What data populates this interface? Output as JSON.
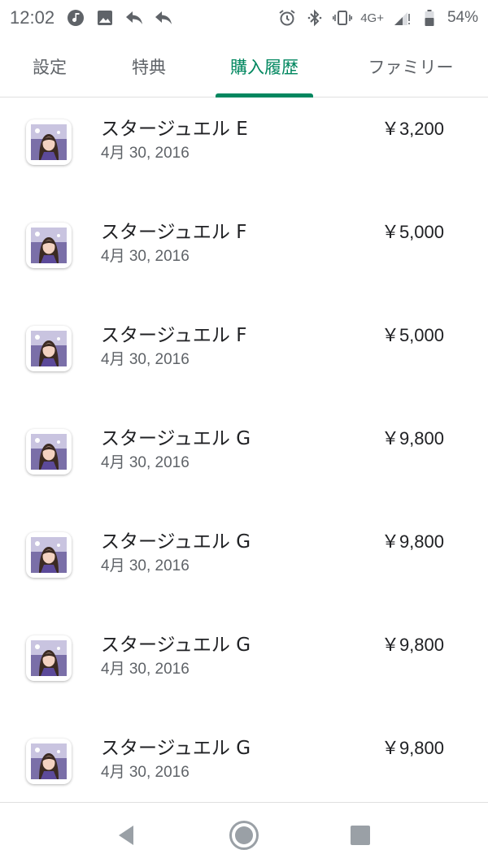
{
  "status_bar": {
    "time": "12:02",
    "network": "4G+",
    "battery": "54%",
    "left_icons": [
      "music-note-icon",
      "image-icon",
      "reply-icon",
      "reply-icon"
    ],
    "right_icons": [
      "alarm-icon",
      "bluetooth-icon",
      "vibrate-icon",
      "signal-icon",
      "battery-icon"
    ]
  },
  "tabs": [
    {
      "label": "設定",
      "active": false
    },
    {
      "label": "特典",
      "active": false
    },
    {
      "label": "購入履歴",
      "active": true
    },
    {
      "label": "ファミリー",
      "active": false
    }
  ],
  "accent_color": "#01875f",
  "purchases": [
    {
      "title": "スタージュエル E",
      "date": "4月 30, 2016",
      "price": "￥3,200"
    },
    {
      "title": "スタージュエル F",
      "date": "4月 30, 2016",
      "price": "￥5,000"
    },
    {
      "title": "スタージュエル F",
      "date": "4月 30, 2016",
      "price": "￥5,000"
    },
    {
      "title": "スタージュエル G",
      "date": "4月 30, 2016",
      "price": "￥9,800"
    },
    {
      "title": "スタージュエル G",
      "date": "4月 30, 2016",
      "price": "￥9,800"
    },
    {
      "title": "スタージュエル G",
      "date": "4月 30, 2016",
      "price": "￥9,800"
    },
    {
      "title": "スタージュエル G",
      "date": "4月 30, 2016",
      "price": "￥9,800"
    }
  ],
  "nav_bar": {
    "icons": [
      "back-icon",
      "home-icon",
      "recents-icon"
    ]
  }
}
